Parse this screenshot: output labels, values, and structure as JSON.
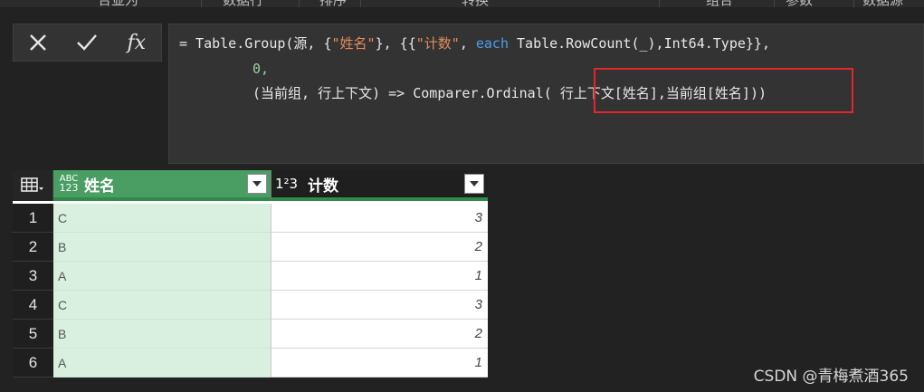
{
  "ribbon": {
    "tabs": [
      "合並为",
      "数据行",
      "排序",
      "转换",
      "组合",
      "参数",
      "数据源"
    ]
  },
  "formula_bar": {
    "cancel_icon": "close-icon",
    "confirm_icon": "check-icon",
    "fx_label": "fx",
    "line1": {
      "p1": "= Table.Group(源, {",
      "s1": "\"姓名\"",
      "p2": "}, {{",
      "s2": "\"计数\"",
      "p3": ", ",
      "kw": "each",
      "p4": " Table.RowCount(_),Int64.Type}},"
    },
    "line2": "0,",
    "line3": {
      "p1": "(当前组, 行上下文) => Comparer.Ordinal( ",
      "p2": "行上下文[姓名],当前组[姓名]))"
    },
    "highlight_color": "#e3262e"
  },
  "table": {
    "columns": [
      {
        "type_label_top": "ABC",
        "type_label_bottom": "123",
        "title": "姓名"
      },
      {
        "type_label": "1²3",
        "title": "计数"
      }
    ],
    "rows": [
      {
        "index": "1",
        "name": "C",
        "count": "3"
      },
      {
        "index": "2",
        "name": "B",
        "count": "2"
      },
      {
        "index": "3",
        "name": "A",
        "count": "1"
      },
      {
        "index": "4",
        "name": "C",
        "count": "3"
      },
      {
        "index": "5",
        "name": "B",
        "count": "2"
      },
      {
        "index": "6",
        "name": "A",
        "count": "1"
      }
    ],
    "header_accent": "#4a9e63"
  },
  "watermark": "CSDN @青梅煮酒365"
}
